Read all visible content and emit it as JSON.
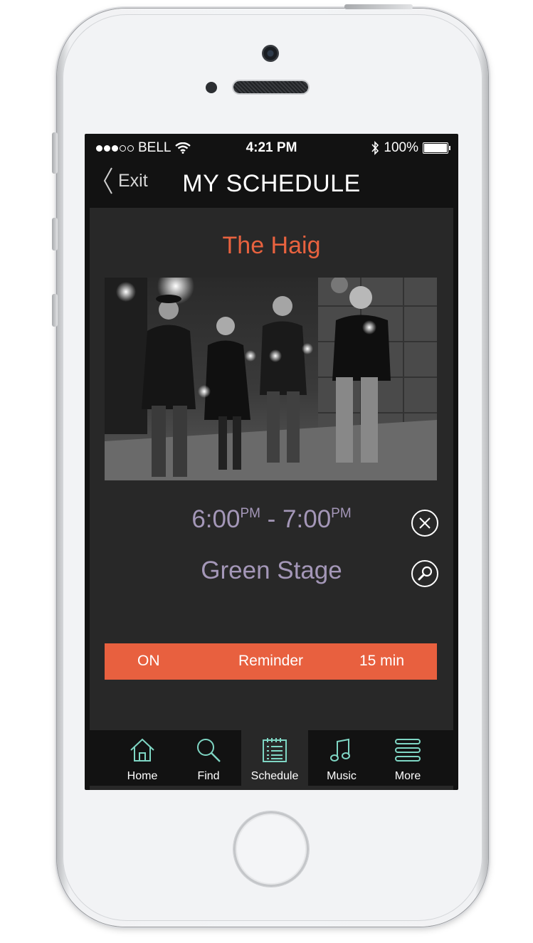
{
  "status_bar": {
    "carrier": "BELL",
    "time": "4:21 PM",
    "battery": "100%"
  },
  "nav": {
    "back_label": "Exit",
    "title": "MY SCHEDULE"
  },
  "event": {
    "name": "The Haig",
    "start_time": "6:00",
    "start_suffix": "PM",
    "separator": " - ",
    "end_time": "7:00",
    "end_suffix": "PM",
    "stage": "Green Stage"
  },
  "reminder": {
    "state": "ON",
    "label": "Reminder",
    "offset": "15 min"
  },
  "tabs": [
    {
      "label": "Home",
      "icon": "home-icon"
    },
    {
      "label": "Find",
      "icon": "search-icon"
    },
    {
      "label": "Schedule",
      "icon": "schedule-icon"
    },
    {
      "label": "Music",
      "icon": "music-note-icon"
    },
    {
      "label": "More",
      "icon": "menu-icon"
    }
  ],
  "active_tab": "Schedule",
  "colors": {
    "accent": "#e8623f",
    "time_text": "#a497b8",
    "tab_icon": "#7fd6c4",
    "screen_bg": "#282828",
    "bar_bg": "#121212"
  }
}
